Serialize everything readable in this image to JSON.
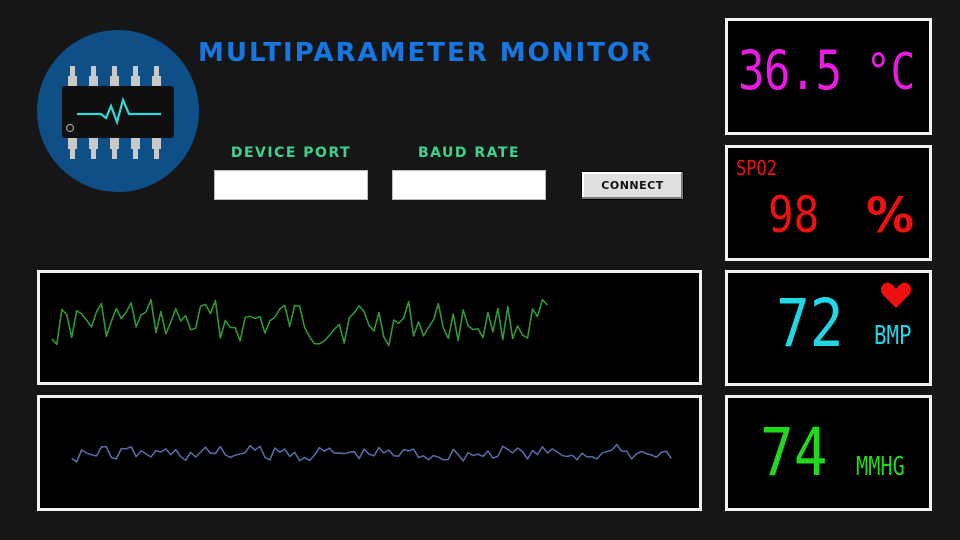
{
  "title": "MULTIPARAMETER MONITOR",
  "logo": {
    "icon": "microchip-heartbeat-icon",
    "circle_color": "#0d4f86"
  },
  "connection": {
    "device_port_label": "DEVICE PORT",
    "device_port_value": "",
    "baud_rate_label": "BAUD RATE",
    "baud_rate_value": "",
    "connect_label": "CONNECT"
  },
  "temperature": {
    "value": "36.5",
    "unit": "°C",
    "color": "#e81be0"
  },
  "spo2": {
    "label": "SPO2",
    "value": "98",
    "unit": "%",
    "color": "#ee1111"
  },
  "heart_rate": {
    "value": "72",
    "unit": "BMP",
    "icon": "heart-icon",
    "color": "#21d7e6",
    "heart_color": "#ee1111"
  },
  "blood_pressure": {
    "value": "74",
    "unit": "MMHG",
    "color": "#24d61c"
  },
  "waveforms": {
    "top_color": "#2f9a3a",
    "bottom_color": "#5a6aa6"
  }
}
